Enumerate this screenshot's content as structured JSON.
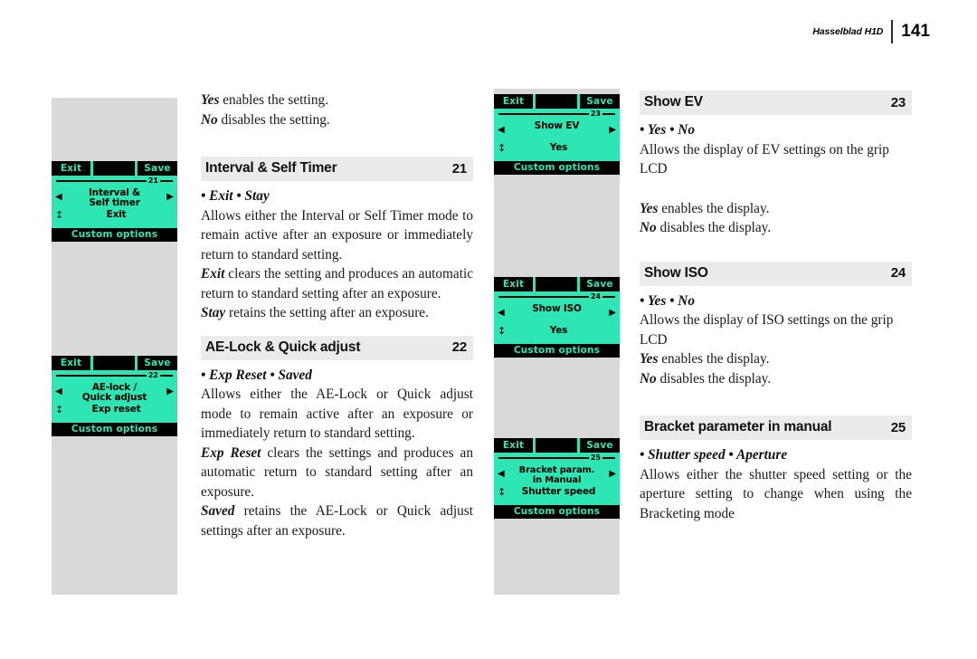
{
  "header": {
    "brand": "Hasselblad H1D",
    "page_number": "141"
  },
  "lcd_screens": [
    {
      "id": "21",
      "exit_label": "Exit",
      "save_label": "Save",
      "number": "21",
      "title": "Interval &\nSelf timer",
      "title_line1": "Interval &",
      "title_line2": "Self timer",
      "value": "Exit",
      "footer": "Custom options",
      "left_arrow": "◀",
      "right_arrow": "▶",
      "updown_arrow": "↕"
    },
    {
      "id": "22",
      "exit_label": "Exit",
      "save_label": "Save",
      "number": "22",
      "title_line1": "AE-lock /",
      "title_line2": "Quick adjust",
      "value": "Exp reset",
      "footer": "Custom options",
      "left_arrow": "◀",
      "right_arrow": "▶",
      "updown_arrow": "↕"
    },
    {
      "id": "23",
      "exit_label": "Exit",
      "save_label": "Save",
      "number": "23",
      "title_line1": "Show EV",
      "title_line2": "",
      "value": "Yes",
      "footer": "Custom options",
      "left_arrow": "◀",
      "right_arrow": "▶",
      "updown_arrow": "↕"
    },
    {
      "id": "24",
      "exit_label": "Exit",
      "save_label": "Save",
      "number": "24",
      "title_line1": "Show ISO",
      "title_line2": "",
      "value": "Yes",
      "footer": "Custom options",
      "left_arrow": "◀",
      "right_arrow": "▶",
      "updown_arrow": "↕"
    },
    {
      "id": "25",
      "exit_label": "Exit",
      "save_label": "Save",
      "number": "25",
      "title_line1": "Bracket param.",
      "title_line2": "in Manual",
      "value": "Shutter speed",
      "footer": "Custom options",
      "left_arrow": "◀",
      "right_arrow": "▶",
      "updown_arrow": "↕"
    }
  ],
  "column_left": {
    "intro": {
      "line1_bold": "Yes",
      "line1_rest": " enables the setting.",
      "line2_bold": "No",
      "line2_rest": " disables the setting."
    },
    "section_interval": {
      "heading": "Interval & Self Timer",
      "number": "21",
      "options": "• Exit • Stay",
      "para1": "Allows either the Interval or Self Timer mode to remain active after an exposure or immediately return to standard setting.",
      "para2_bold": "Exit",
      "para2_rest": " clears the setting and produces an automatic return to standard setting after an exposure.",
      "para3_bold": "Stay",
      "para3_rest": " retains the setting after an exposure."
    },
    "section_aelock": {
      "heading": "AE-Lock & Quick adjust",
      "number": "22",
      "options": "• Exp Reset • Saved",
      "para1": "Allows either the AE-Lock or Quick adjust mode to remain active after an exposure or immediately return to standard setting.",
      "para2_bold": "Exp Reset",
      "para2_rest": " clears the settings and produces an automatic return to standard setting after an exposure.",
      "para3_bold": "Saved",
      "para3_rest": " retains the AE-Lock or Quick adjust settings after an exposure."
    }
  },
  "column_right": {
    "section_showev": {
      "heading": "Show EV",
      "number": "23",
      "options": "• Yes • No",
      "para1": "Allows the display of EV settings on the grip LCD",
      "para2_bold": "Yes",
      "para2_rest": " enables the display.",
      "para3_bold": "No",
      "para3_rest": " disables the display."
    },
    "section_showiso": {
      "heading": "Show ISO",
      "number": "24",
      "options": "• Yes • No",
      "para1": "Allows the display of ISO settings on the grip LCD",
      "para2_bold": "Yes",
      "para2_rest": " enables the display.",
      "para3_bold": "No",
      "para3_rest": " disables the display."
    },
    "section_bracket": {
      "heading": "Bracket parameter in manual",
      "number": "25",
      "options": "• Shutter speed • Aperture",
      "para1": "Allows either the shutter speed setting or the aperture setting to change when using the Bracketing mode"
    }
  },
  "colors": {
    "lcd_background": "#2ee6b4",
    "lcd_foreground": "#000000",
    "heading_band": "#ebebeb",
    "gray_column": "#d9d9d9"
  }
}
